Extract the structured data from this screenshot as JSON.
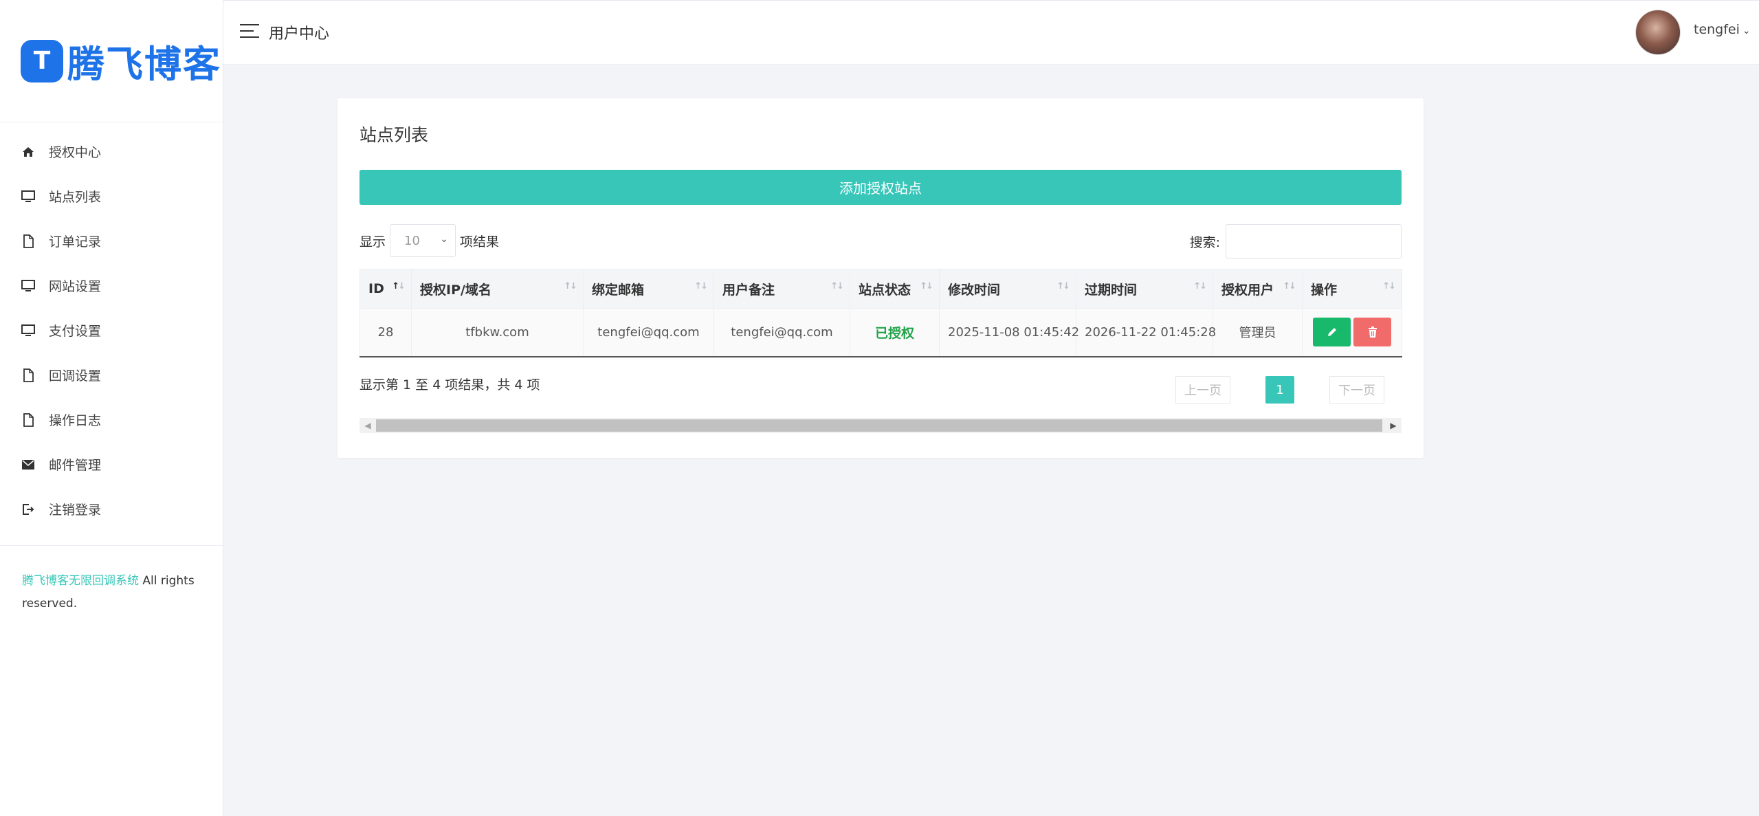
{
  "brand": {
    "logo_mark": "T",
    "logo_text": "腾飞博客",
    "color": "#1e73e8"
  },
  "sidebar": {
    "items": [
      {
        "label": "授权中心",
        "icon": "home-icon"
      },
      {
        "label": "站点列表",
        "icon": "monitor-icon"
      },
      {
        "label": "订单记录",
        "icon": "file-icon"
      },
      {
        "label": "网站设置",
        "icon": "monitor-icon"
      },
      {
        "label": "支付设置",
        "icon": "monitor-icon"
      },
      {
        "label": "回调设置",
        "icon": "file-icon"
      },
      {
        "label": "操作日志",
        "icon": "file-icon"
      },
      {
        "label": "邮件管理",
        "icon": "mail-icon"
      },
      {
        "label": "注销登录",
        "icon": "logout-icon"
      }
    ],
    "footer_link": "腾飞博客无限回调系统",
    "footer_text": " All rights reserved."
  },
  "header": {
    "title": "用户中心",
    "username": "tengfei"
  },
  "card": {
    "title": "站点列表",
    "add_button": "添加授权站点",
    "length_prefix": "显示",
    "length_value": "10",
    "length_suffix": "项结果",
    "search_label": "搜索:",
    "search_value": ""
  },
  "table": {
    "columns": [
      "ID",
      "授权IP/域名",
      "绑定邮箱",
      "用户备注",
      "站点状态",
      "修改时间",
      "过期时间",
      "授权用户",
      "操作"
    ],
    "rows": [
      {
        "id": "28",
        "domain": "tfbkw.com",
        "email": "tengfei@qq.com",
        "note": "tengfei@qq.com",
        "status": "已授权",
        "modified": "2025-11-08 01:45:42",
        "expires": "2026-11-22 01:45:28",
        "user": "管理员"
      }
    ]
  },
  "pagination": {
    "info": "显示第 1 至 4 项结果，共 4 项",
    "prev": "上一页",
    "current": "1",
    "next": "下一页"
  },
  "colors": {
    "accent": "#37c6b8",
    "edit": "#18b96a",
    "delete": "#f26b6b",
    "status_ok": "#22a34a"
  }
}
